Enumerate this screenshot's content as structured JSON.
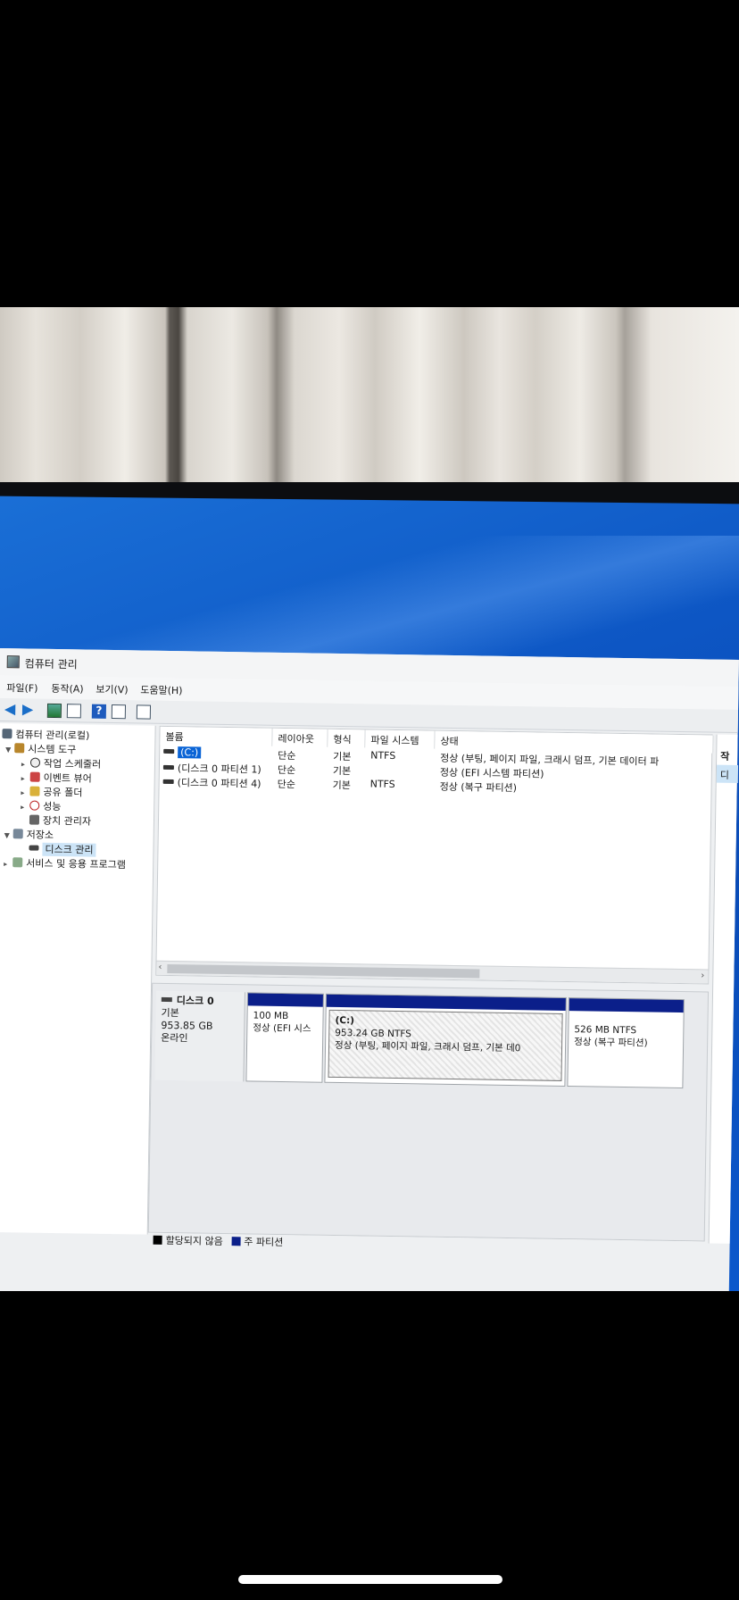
{
  "window": {
    "title": "컴퓨터 관리"
  },
  "menu": [
    "파일(F)",
    "동작(A)",
    "보기(V)",
    "도움말(H)"
  ],
  "toolbar": {
    "help_glyph": "?"
  },
  "tree": {
    "root": "컴퓨터 관리(로컬)",
    "system_tools": "시스템 도구",
    "task_scheduler": "작업 스케줄러",
    "event_viewer": "이벤트 뷰어",
    "shared_folders": "공유 폴더",
    "performance": "성능",
    "device_manager": "장치 관리자",
    "storage": "저장소",
    "disk_management": "디스크 관리",
    "services_apps": "서비스 및 응용 프로그램"
  },
  "volumes": {
    "headers": [
      "볼륨",
      "레이아웃",
      "형식",
      "파일 시스템",
      "상태"
    ],
    "rows": [
      {
        "volume": "(C:)",
        "layout": "단순",
        "type": "기본",
        "fs": "NTFS",
        "status": "정상 (부팅, 페이지 파일, 크래시 덤프, 기본 데이터 파"
      },
      {
        "volume": "(디스크 0 파티션 1)",
        "layout": "단순",
        "type": "기본",
        "fs": "",
        "status": "정상 (EFI 시스템 파티션)"
      },
      {
        "volume": "(디스크 0 파티션 4)",
        "layout": "단순",
        "type": "기본",
        "fs": "NTFS",
        "status": "정상 (복구 파티션)"
      }
    ]
  },
  "disk0": {
    "name": "디스크 0",
    "kind": "기본",
    "size": "953.85 GB",
    "state": "온라인",
    "partitions": [
      {
        "title": "",
        "line1": "100 MB",
        "line2": "정상 (EFI 시스"
      },
      {
        "title": "(C:)",
        "line1": "953.24 GB NTFS",
        "line2": "정상 (부팅, 페이지 파일, 크래시 덤프, 기본 데0"
      },
      {
        "title": "",
        "line1": "526 MB NTFS",
        "line2": "정상 (복구 파티션)"
      }
    ]
  },
  "legend": {
    "unallocated": "할당되지 않음",
    "primary": "주 파티션"
  },
  "actions": {
    "header": "작",
    "item": "디"
  },
  "colors": {
    "primary_partition": "#0b1f8a",
    "unallocated": "#000000",
    "selection": "#0a64d6",
    "desktop": "#0d56c4"
  }
}
